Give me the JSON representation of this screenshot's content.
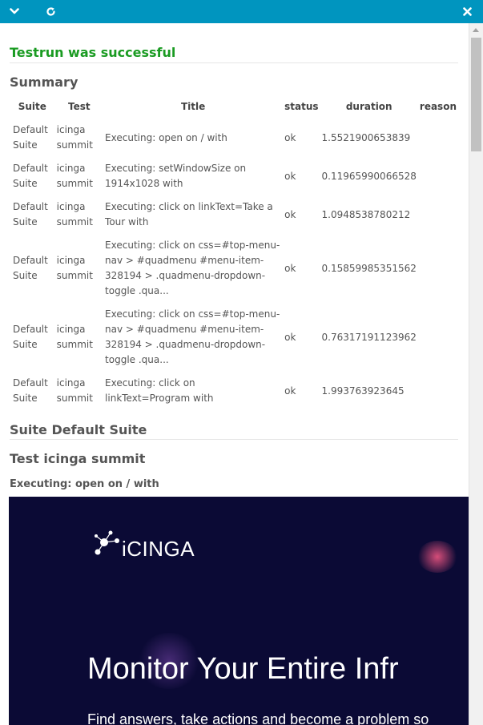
{
  "toolbar": {
    "collapse_icon": "chevron-down-icon",
    "refresh_icon": "refresh-icon",
    "close_icon": "close-icon",
    "color": "#0095bf"
  },
  "result": {
    "message": "Testrun was successful",
    "color": "#1a9b22"
  },
  "summary": {
    "heading": "Summary",
    "columns": [
      "Suite",
      "Test",
      "Title",
      "status",
      "duration",
      "reason"
    ],
    "rows": [
      {
        "suite": "Default Suite",
        "test": "icinga summit",
        "title": "Executing: open on / with",
        "status": "ok",
        "duration": "1.5521900653839",
        "reason": ""
      },
      {
        "suite": "Default Suite",
        "test": "icinga summit",
        "title": "Executing: setWindowSize on 1914x1028 with",
        "status": "ok",
        "duration": "0.11965990066528",
        "reason": ""
      },
      {
        "suite": "Default Suite",
        "test": "icinga summit",
        "title": "Executing: click on linkText=Take a Tour with",
        "status": "ok",
        "duration": "1.0948538780212",
        "reason": ""
      },
      {
        "suite": "Default Suite",
        "test": "icinga summit",
        "title": "Executing: click on css=#top-menu-nav > #quadmenu #menu-item-328194 > .quadmenu-dropdown-toggle .qua...",
        "status": "ok",
        "duration": "0.15859985351562",
        "reason": ""
      },
      {
        "suite": "Default Suite",
        "test": "icinga summit",
        "title": "Executing: click on css=#top-menu-nav > #quadmenu #menu-item-328194 > .quadmenu-dropdown-toggle .qua...",
        "status": "ok",
        "duration": "0.76317191123962",
        "reason": ""
      },
      {
        "suite": "Default Suite",
        "test": "icinga summit",
        "title": "Executing: click on linkText=Program with",
        "status": "ok",
        "duration": "1.993763923645",
        "reason": ""
      }
    ]
  },
  "suite_section": {
    "heading": "Suite Default Suite",
    "test_heading": "Test icinga summit",
    "step_heading": "Executing: open on / with"
  },
  "screenshot": {
    "logo_text": "iCINGA",
    "headline": "Monitor Your Entire Infr",
    "subline": "Find answers, take actions and become a problem so",
    "background": "#0b0a35"
  }
}
